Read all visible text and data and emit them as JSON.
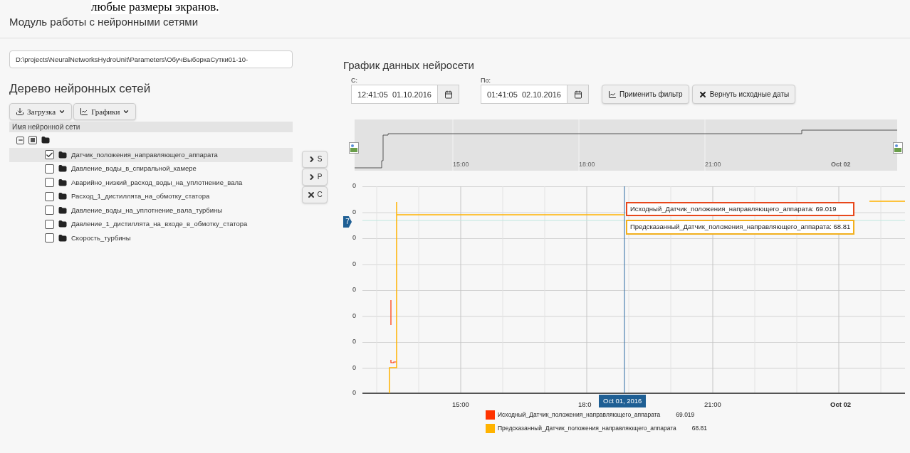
{
  "document_text": "любые размеры экранов.",
  "title": "Модуль работы с нейронными сетями",
  "path_field": {
    "value": "D:\\projects\\NeuralNetworksHydroUnit\\Parameters\\ОбучВыборкаСутки01-10-"
  },
  "tree": {
    "heading": "Дерево нейронных сетей",
    "toolbar": [
      {
        "label": "Загрузка",
        "kind": "download"
      },
      {
        "label": "Графики",
        "kind": "chart"
      }
    ],
    "column": "Имя нейронной сети",
    "root": {
      "expanded": true,
      "indeterminate": true
    },
    "items": [
      {
        "label": "Датчик_положения_направляющего_аппарата",
        "checked": true,
        "selected": true
      },
      {
        "label": "Давление_воды_в_спиральной_камере",
        "checked": false,
        "selected": false
      },
      {
        "label": "Аварийно_низкий_расход_воды_на_уплотнение_вала",
        "checked": false,
        "selected": false
      },
      {
        "label": "Расход_1_дистиллята_на_обмотку_статора",
        "checked": false,
        "selected": false
      },
      {
        "label": "Давление_воды_на_уплотнение_вала_турбины",
        "checked": false,
        "selected": false
      },
      {
        "label": "Давление_1_дистиллята_на_входе_в_обмотку_статора",
        "checked": false,
        "selected": false
      },
      {
        "label": "Скорость_турбины",
        "checked": false,
        "selected": false
      }
    ]
  },
  "side_buttons": [
    {
      "label": "S",
      "kind": "chevron"
    },
    {
      "label": "P",
      "kind": "chevron"
    },
    {
      "label": "C",
      "kind": "times"
    }
  ],
  "chart_panel": {
    "heading": "График данных нейросети",
    "from": {
      "label": "С:",
      "value": "12:41:05  01.10.2016"
    },
    "to": {
      "label": "По:",
      "value": "01:41:05  02.10.2016"
    },
    "buttons": [
      {
        "label": "Применить фильтр",
        "kind": "chart"
      },
      {
        "label": "Вернуть исходные даты",
        "kind": "times"
      }
    ],
    "navigator": {
      "x_labels": [
        {
          "text": "15:00",
          "bold": false
        },
        {
          "text": "18:00",
          "bold": false
        },
        {
          "text": "21:00",
          "bold": false
        },
        {
          "text": "Oct 02",
          "bold": true
        }
      ]
    },
    "chart": {
      "y_labels": [
        "0",
        "0",
        "0",
        "0",
        "0",
        "0",
        "0",
        "0",
        "0"
      ],
      "marker": "7",
      "x_labels": [
        {
          "text": "15:00",
          "bold": false
        },
        {
          "text": "18:0",
          "bold": false
        },
        {
          "text": "21:00",
          "bold": false
        },
        {
          "text": "Oct 02",
          "bold": true
        }
      ],
      "crosshair_label": "Oct 01, 2016",
      "tooltips": [
        {
          "text": "Исходный_Датчик_положения_направляющего_аппарата: 69.019",
          "color": "#e8481c"
        },
        {
          "text": "Предсказанный_Датчик_положения_направляющего_аппарата: 68.81",
          "color": "#f2b01e"
        }
      ],
      "legend": [
        {
          "name": "Исходный_Датчик_положения_направляющего_аппарата",
          "value": "69.019",
          "color": "#ff3300"
        },
        {
          "name": "Предсказанный_Датчик_положения_направляющего_аппарата",
          "value": "68.81",
          "color": "#ffb300"
        }
      ]
    }
  }
}
